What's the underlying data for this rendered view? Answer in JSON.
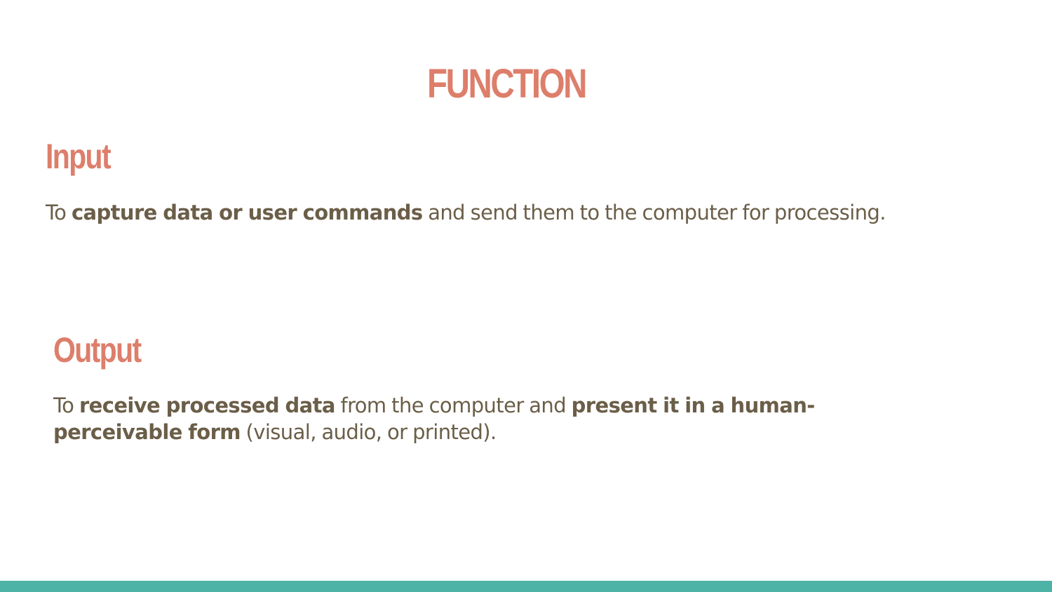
{
  "slide": {
    "title": "FUNCTION"
  },
  "input": {
    "heading": "Input",
    "text_prefix": "To ",
    "text_bold": "capture data or user commands",
    "text_suffix": " and send them to the computer for processing."
  },
  "output": {
    "heading": "Output",
    "text_prefix": "To ",
    "text_bold_1": "receive processed data",
    "text_middle": " from the computer and ",
    "text_bold_2": "present it in a human-perceivable form",
    "text_suffix": " (visual, audio, or printed)."
  },
  "colors": {
    "heading": "#dd7e6b",
    "body_text": "#6b5e48",
    "footer_bar": "#4db3a6"
  }
}
